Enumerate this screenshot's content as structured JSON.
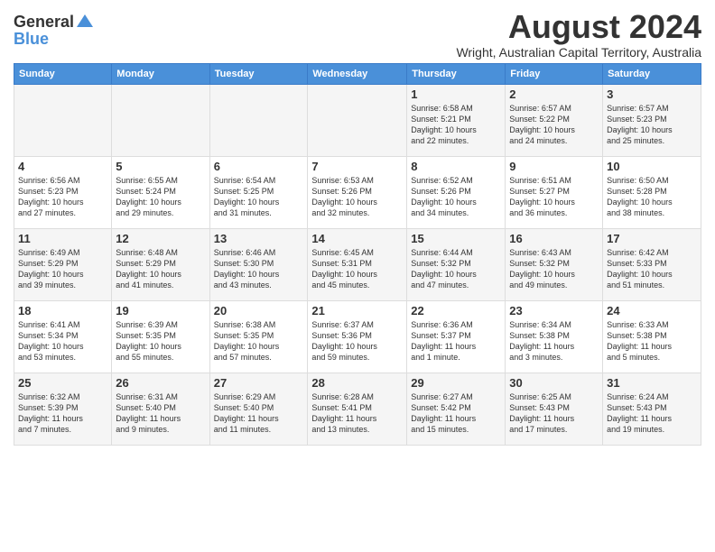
{
  "header": {
    "logo_general": "General",
    "logo_blue": "Blue",
    "month_year": "August 2024",
    "location": "Wright, Australian Capital Territory, Australia"
  },
  "days_of_week": [
    "Sunday",
    "Monday",
    "Tuesday",
    "Wednesday",
    "Thursday",
    "Friday",
    "Saturday"
  ],
  "weeks": [
    [
      {
        "day": "",
        "info": ""
      },
      {
        "day": "",
        "info": ""
      },
      {
        "day": "",
        "info": ""
      },
      {
        "day": "",
        "info": ""
      },
      {
        "day": "1",
        "info": "Sunrise: 6:58 AM\nSunset: 5:21 PM\nDaylight: 10 hours\nand 22 minutes."
      },
      {
        "day": "2",
        "info": "Sunrise: 6:57 AM\nSunset: 5:22 PM\nDaylight: 10 hours\nand 24 minutes."
      },
      {
        "day": "3",
        "info": "Sunrise: 6:57 AM\nSunset: 5:23 PM\nDaylight: 10 hours\nand 25 minutes."
      }
    ],
    [
      {
        "day": "4",
        "info": "Sunrise: 6:56 AM\nSunset: 5:23 PM\nDaylight: 10 hours\nand 27 minutes."
      },
      {
        "day": "5",
        "info": "Sunrise: 6:55 AM\nSunset: 5:24 PM\nDaylight: 10 hours\nand 29 minutes."
      },
      {
        "day": "6",
        "info": "Sunrise: 6:54 AM\nSunset: 5:25 PM\nDaylight: 10 hours\nand 31 minutes."
      },
      {
        "day": "7",
        "info": "Sunrise: 6:53 AM\nSunset: 5:26 PM\nDaylight: 10 hours\nand 32 minutes."
      },
      {
        "day": "8",
        "info": "Sunrise: 6:52 AM\nSunset: 5:26 PM\nDaylight: 10 hours\nand 34 minutes."
      },
      {
        "day": "9",
        "info": "Sunrise: 6:51 AM\nSunset: 5:27 PM\nDaylight: 10 hours\nand 36 minutes."
      },
      {
        "day": "10",
        "info": "Sunrise: 6:50 AM\nSunset: 5:28 PM\nDaylight: 10 hours\nand 38 minutes."
      }
    ],
    [
      {
        "day": "11",
        "info": "Sunrise: 6:49 AM\nSunset: 5:29 PM\nDaylight: 10 hours\nand 39 minutes."
      },
      {
        "day": "12",
        "info": "Sunrise: 6:48 AM\nSunset: 5:29 PM\nDaylight: 10 hours\nand 41 minutes."
      },
      {
        "day": "13",
        "info": "Sunrise: 6:46 AM\nSunset: 5:30 PM\nDaylight: 10 hours\nand 43 minutes."
      },
      {
        "day": "14",
        "info": "Sunrise: 6:45 AM\nSunset: 5:31 PM\nDaylight: 10 hours\nand 45 minutes."
      },
      {
        "day": "15",
        "info": "Sunrise: 6:44 AM\nSunset: 5:32 PM\nDaylight: 10 hours\nand 47 minutes."
      },
      {
        "day": "16",
        "info": "Sunrise: 6:43 AM\nSunset: 5:32 PM\nDaylight: 10 hours\nand 49 minutes."
      },
      {
        "day": "17",
        "info": "Sunrise: 6:42 AM\nSunset: 5:33 PM\nDaylight: 10 hours\nand 51 minutes."
      }
    ],
    [
      {
        "day": "18",
        "info": "Sunrise: 6:41 AM\nSunset: 5:34 PM\nDaylight: 10 hours\nand 53 minutes."
      },
      {
        "day": "19",
        "info": "Sunrise: 6:39 AM\nSunset: 5:35 PM\nDaylight: 10 hours\nand 55 minutes."
      },
      {
        "day": "20",
        "info": "Sunrise: 6:38 AM\nSunset: 5:35 PM\nDaylight: 10 hours\nand 57 minutes."
      },
      {
        "day": "21",
        "info": "Sunrise: 6:37 AM\nSunset: 5:36 PM\nDaylight: 10 hours\nand 59 minutes."
      },
      {
        "day": "22",
        "info": "Sunrise: 6:36 AM\nSunset: 5:37 PM\nDaylight: 11 hours\nand 1 minute."
      },
      {
        "day": "23",
        "info": "Sunrise: 6:34 AM\nSunset: 5:38 PM\nDaylight: 11 hours\nand 3 minutes."
      },
      {
        "day": "24",
        "info": "Sunrise: 6:33 AM\nSunset: 5:38 PM\nDaylight: 11 hours\nand 5 minutes."
      }
    ],
    [
      {
        "day": "25",
        "info": "Sunrise: 6:32 AM\nSunset: 5:39 PM\nDaylight: 11 hours\nand 7 minutes."
      },
      {
        "day": "26",
        "info": "Sunrise: 6:31 AM\nSunset: 5:40 PM\nDaylight: 11 hours\nand 9 minutes."
      },
      {
        "day": "27",
        "info": "Sunrise: 6:29 AM\nSunset: 5:40 PM\nDaylight: 11 hours\nand 11 minutes."
      },
      {
        "day": "28",
        "info": "Sunrise: 6:28 AM\nSunset: 5:41 PM\nDaylight: 11 hours\nand 13 minutes."
      },
      {
        "day": "29",
        "info": "Sunrise: 6:27 AM\nSunset: 5:42 PM\nDaylight: 11 hours\nand 15 minutes."
      },
      {
        "day": "30",
        "info": "Sunrise: 6:25 AM\nSunset: 5:43 PM\nDaylight: 11 hours\nand 17 minutes."
      },
      {
        "day": "31",
        "info": "Sunrise: 6:24 AM\nSunset: 5:43 PM\nDaylight: 11 hours\nand 19 minutes."
      }
    ]
  ]
}
